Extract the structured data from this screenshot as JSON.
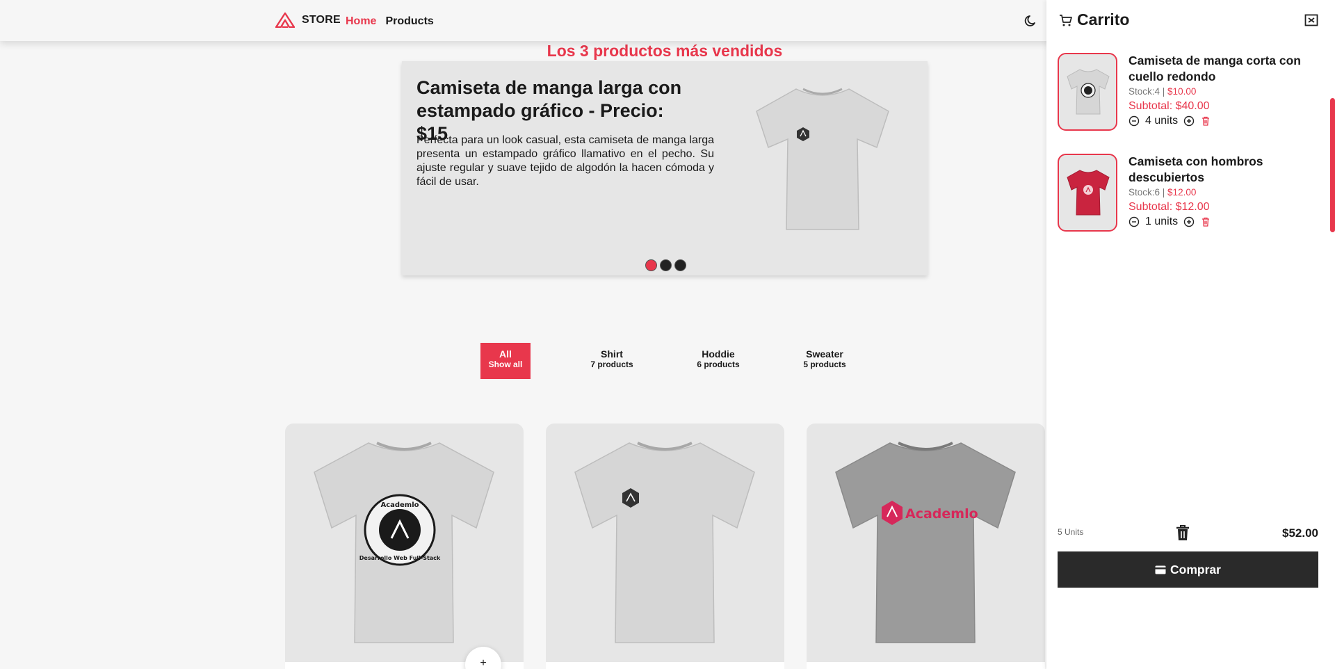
{
  "header": {
    "brand": "STORE",
    "nav": [
      {
        "label": "Home",
        "active": true
      },
      {
        "label": "Products",
        "active": false
      }
    ],
    "theme_icon": "moon-icon"
  },
  "hero": {
    "heading": "Los 3 productos más vendidos",
    "title": "Camiseta de manga larga con estampado gráfico - Precio: $15",
    "description": "Perfecta para un look casual, esta camiseta de manga larga presenta un estampado gráfico llamativo en el pecho. Su ajuste regular y suave tejido de algodón la hacen cómoda y fácil de usar.",
    "slide_count": 3,
    "active_slide": 1
  },
  "filters": [
    {
      "label": "All",
      "sub": "Show all",
      "active": true
    },
    {
      "label": "Shirt",
      "sub": "7 products",
      "active": false
    },
    {
      "label": "Hoddie",
      "sub": "6 products",
      "active": false
    },
    {
      "label": "Sweater",
      "sub": "5 products",
      "active": false
    }
  ],
  "products": [
    {
      "print_line1": "Academlo",
      "print_line2": "Desarrollo Web Full-Stack"
    },
    {
      "print": "logo"
    },
    {
      "print": "Academlo"
    }
  ],
  "add_button": "+",
  "cart": {
    "title": "Carrito",
    "items": [
      {
        "name": "Camiseta de manga corta con cuello redondo",
        "stock": "Stock:4",
        "price": "$10.00",
        "subtotal": "Subtotal: $40.00",
        "units": "4 units"
      },
      {
        "name": "Camiseta con hombros descubiertos",
        "stock": "Stock:6",
        "price": "$12.00",
        "subtotal": "Subtotal: $12.00",
        "units": "1 units"
      }
    ],
    "total_units": "5 Units",
    "total": "$52.00",
    "buy_label": "Comprar"
  },
  "colors": {
    "accent": "#e8374c",
    "dark": "#2a2a2a",
    "background": "#f6f6f6"
  }
}
